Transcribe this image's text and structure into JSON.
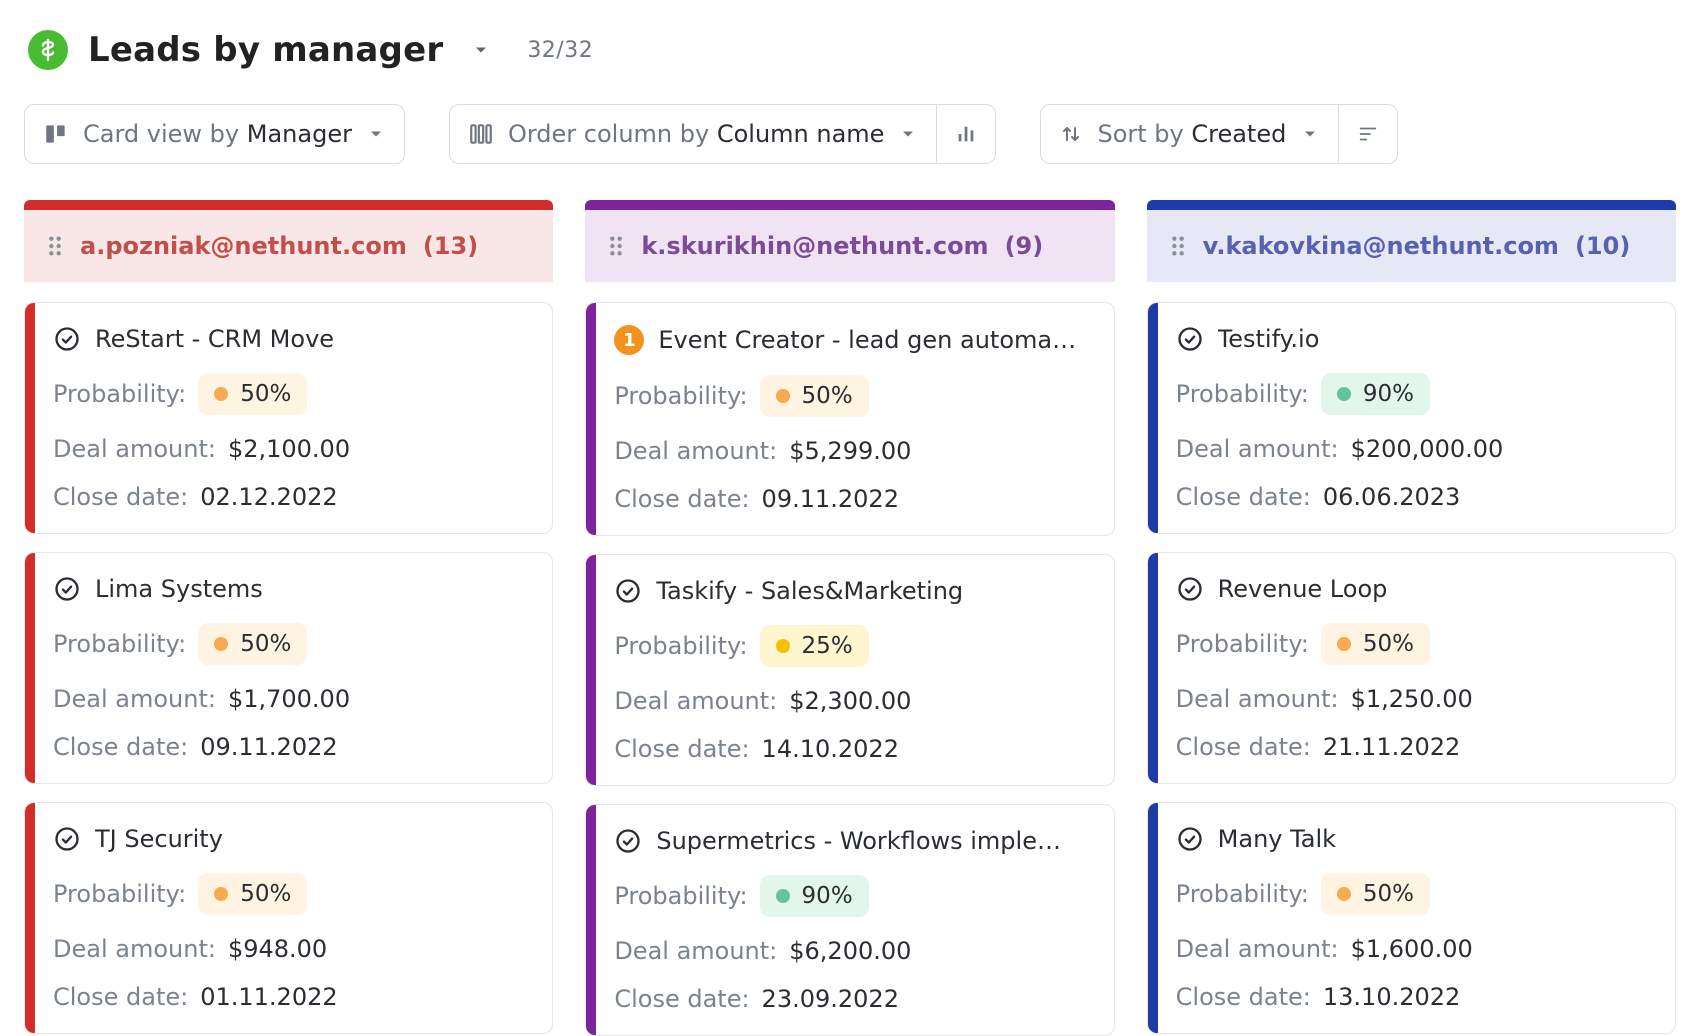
{
  "header": {
    "title": "Leads by manager",
    "counter": "32/32"
  },
  "toolbar": {
    "cardView": {
      "prefix": "Card view by",
      "value": "Manager"
    },
    "orderColumn": {
      "prefix": "Order column by",
      "value": "Column name"
    },
    "sortBy": {
      "prefix": "Sort by",
      "value": "Created"
    }
  },
  "columns": [
    {
      "id": "col-1",
      "title": "a.pozniak@nethunt.com",
      "count": "(13)",
      "topbarClass": "tb-red",
      "headerClass": "hdr-red",
      "stripeColor": "#d12e2a",
      "cards": [
        {
          "title": "ReStart - CRM Move",
          "badge": "check",
          "probability": {
            "pct": "50%",
            "pillClass": "pill-orange"
          },
          "dealAmount": "$2,100.00",
          "closeDate": "02.12.2022"
        },
        {
          "title": "Lima Systems",
          "badge": "check",
          "probability": {
            "pct": "50%",
            "pillClass": "pill-orange"
          },
          "dealAmount": "$1,700.00",
          "closeDate": "09.11.2022"
        },
        {
          "title": "TJ Security",
          "badge": "check",
          "probability": {
            "pct": "50%",
            "pillClass": "pill-orange"
          },
          "dealAmount": "$948.00",
          "closeDate": "01.11.2022"
        }
      ]
    },
    {
      "id": "col-2",
      "title": "k.skurikhin@nethunt.com",
      "count": "(9)",
      "topbarClass": "tb-purple",
      "headerClass": "hdr-purple",
      "stripeColor": "#7c239d",
      "cards": [
        {
          "title": "Event Creator - lead gen automa…",
          "badge": "num",
          "badgeText": "1",
          "probability": {
            "pct": "50%",
            "pillClass": "pill-orange"
          },
          "dealAmount": "$5,299.00",
          "closeDate": "09.11.2022"
        },
        {
          "title": "Taskify - Sales&Marketing",
          "badge": "check",
          "probability": {
            "pct": "25%",
            "pillClass": "pill-yellow"
          },
          "dealAmount": "$2,300.00",
          "closeDate": "14.10.2022"
        },
        {
          "title": "Supermetrics - Workflows imple…",
          "badge": "check",
          "probability": {
            "pct": "90%",
            "pillClass": "pill-green"
          },
          "dealAmount": "$6,200.00",
          "closeDate": "23.09.2022"
        }
      ]
    },
    {
      "id": "col-3",
      "title": "v.kakovkina@nethunt.com",
      "count": "(10)",
      "topbarClass": "tb-blue",
      "headerClass": "hdr-blue",
      "stripeColor": "#1f3aa9",
      "cards": [
        {
          "title": "Testify.io",
          "badge": "check",
          "probability": {
            "pct": "90%",
            "pillClass": "pill-green"
          },
          "dealAmount": "$200,000.00",
          "closeDate": "06.06.2023"
        },
        {
          "title": "Revenue Loop",
          "badge": "check",
          "probability": {
            "pct": "50%",
            "pillClass": "pill-orange"
          },
          "dealAmount": "$1,250.00",
          "closeDate": "21.11.2022"
        },
        {
          "title": "Many Talk",
          "badge": "check",
          "probability": {
            "pct": "50%",
            "pillClass": "pill-orange"
          },
          "dealAmount": "$1,600.00",
          "closeDate": "13.10.2022"
        }
      ]
    }
  ],
  "labels": {
    "probability": "Probability:",
    "dealAmount": "Deal amount:",
    "closeDate": "Close date:"
  }
}
